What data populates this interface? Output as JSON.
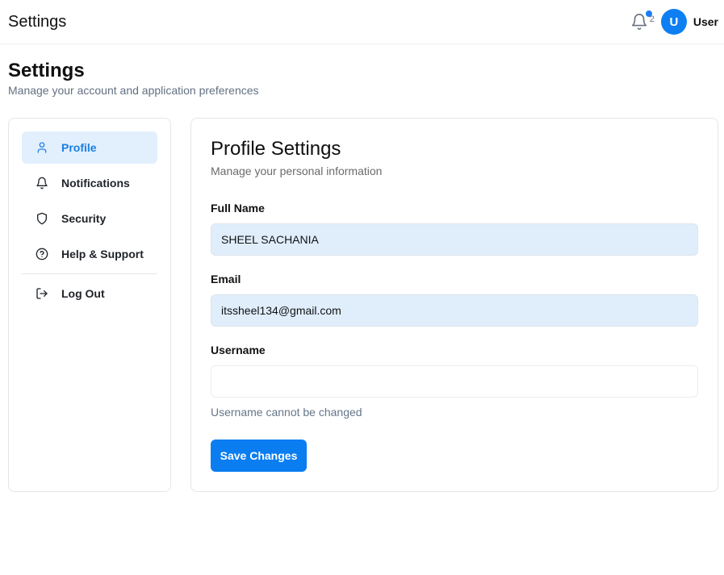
{
  "header": {
    "app_title": "Settings",
    "notification_count": "2",
    "avatar_initial": "U",
    "user_name": "User",
    "icons": {
      "bell": "bell-icon"
    }
  },
  "page": {
    "title": "Settings",
    "subtitle": "Manage your account and application preferences"
  },
  "sidebar": {
    "items": [
      {
        "label": "Profile",
        "icon": "user-icon",
        "active": true
      },
      {
        "label": "Notifications",
        "icon": "bell-icon",
        "active": false
      },
      {
        "label": "Security",
        "icon": "shield-icon",
        "active": false
      },
      {
        "label": "Help & Support",
        "icon": "help-circle-icon",
        "active": false
      }
    ],
    "logout": {
      "label": "Log Out",
      "icon": "logout-icon"
    }
  },
  "profile": {
    "title": "Profile Settings",
    "subtitle": "Manage your personal information",
    "fields": {
      "full_name": {
        "label": "Full Name",
        "value": "SHEEL SACHANIA"
      },
      "email": {
        "label": "Email",
        "value": "itssheel134@gmail.com"
      },
      "username": {
        "label": "Username",
        "value": ""
      }
    },
    "username_helper": "Username cannot be changed",
    "save_label": "Save Changes"
  },
  "colors": {
    "accent": "#0a7df1",
    "active_nav_bg": "#e2effd",
    "input_bg": "#e0eefc",
    "muted_text": "#637083"
  }
}
